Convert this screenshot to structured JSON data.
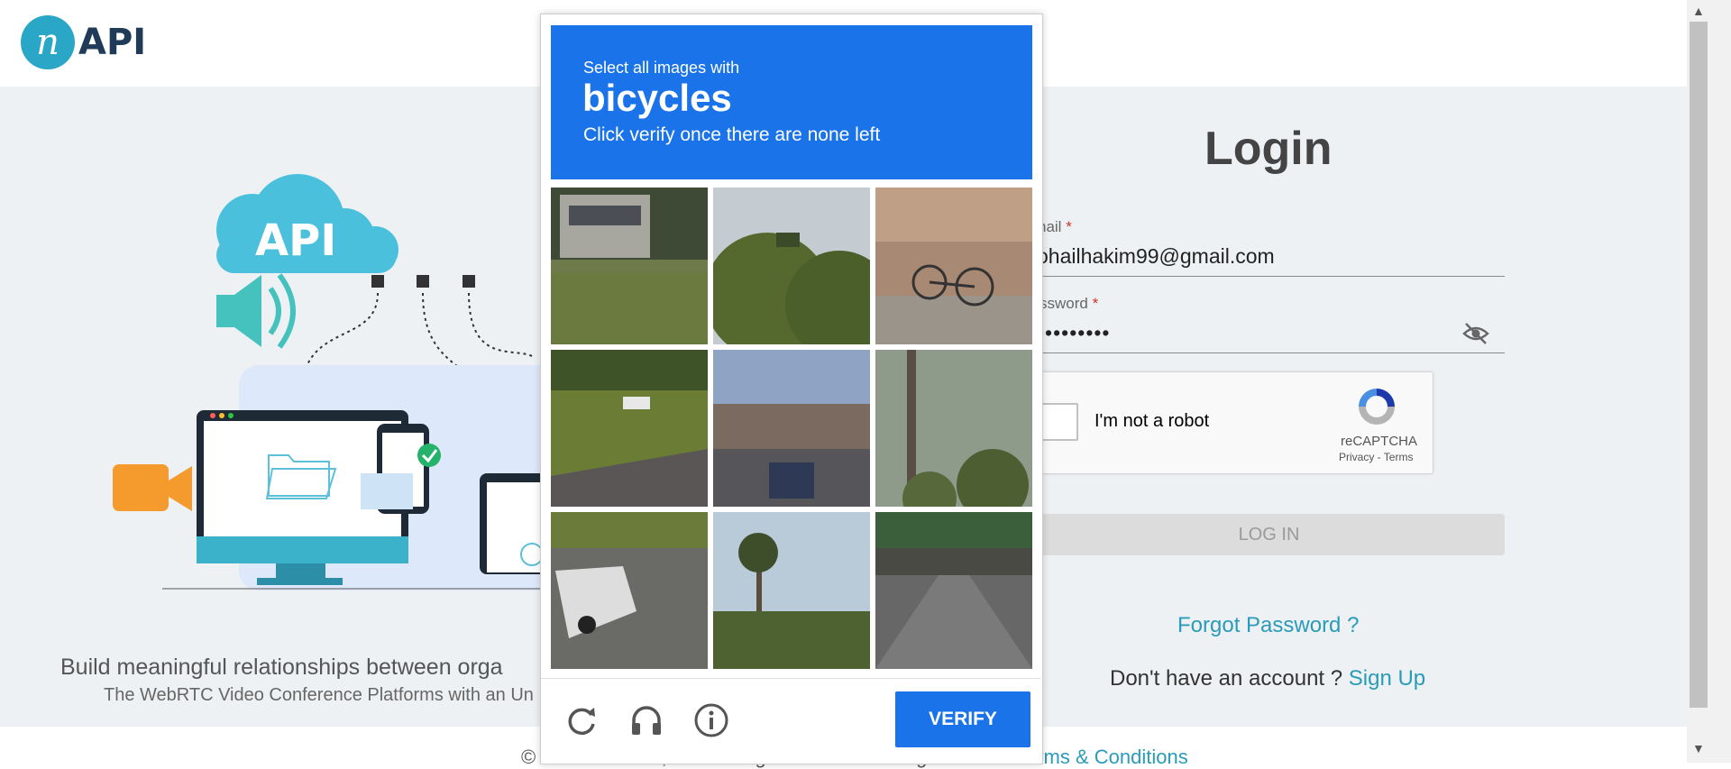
{
  "brand": {
    "logo_letter": "n",
    "name": "API"
  },
  "illustration": {
    "cloud_label": "API"
  },
  "hero": {
    "tagline": "Build meaningful relationships between orga",
    "subtagline": "The WebRTC Video Conference Platforms with an Un"
  },
  "login": {
    "title": "Login",
    "email_label": "nail",
    "email_value": "ohailhakim99@gmail.com",
    "password_label": "ssword",
    "password_value": "•••••••••",
    "required_mark": "*",
    "login_button": "LOG IN",
    "forgot_password": "Forgot Password ?",
    "no_account": "Don't have an account ?",
    "sign_up": "Sign Up"
  },
  "recaptcha": {
    "label": "I'm not a robot",
    "brand": "reCAPTCHA",
    "links": "Privacy - Terms"
  },
  "challenge": {
    "intro": "Select all images with",
    "object": "bicycles",
    "instruction": "Click verify once there are none left",
    "verify_label": "VERIFY",
    "tiles": [
      {
        "scene": "truck-on-grass"
      },
      {
        "scene": "trees-with-sign"
      },
      {
        "scene": "bicycles-by-wall"
      },
      {
        "scene": "car-on-highway"
      },
      {
        "scene": "city-street"
      },
      {
        "scene": "trees-and-pole"
      },
      {
        "scene": "white-car-road"
      },
      {
        "scene": "palm-tree-bushes"
      },
      {
        "scene": "highway-overpass"
      }
    ]
  },
  "footer": {
    "text": "© 2023 InstaVC, Inc. All Rights Reserved. I agree to the",
    "terms_link": "Terms & Conditions"
  },
  "scrollbar": {
    "up_arrow": "▲",
    "down_arrow": "▼"
  },
  "colors": {
    "accent": "#2aa6c6",
    "challenge_blue": "#1a73e8",
    "link": "#2a9bb8"
  }
}
